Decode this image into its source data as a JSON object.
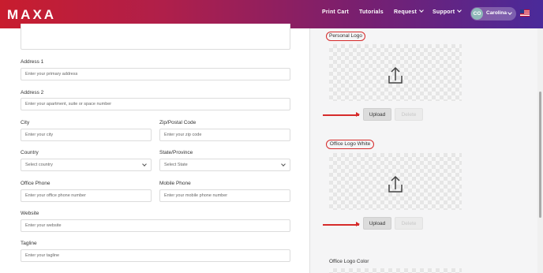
{
  "header": {
    "logo": "MAXA",
    "nav": [
      "Print Cart",
      "Tutorials",
      "Request",
      "Support"
    ],
    "user": {
      "initials": "CO",
      "name": "Carolina"
    }
  },
  "form": {
    "address1": {
      "label": "Address 1",
      "placeholder": "Enter your primary address"
    },
    "address2": {
      "label": "Address 2",
      "placeholder": "Enter your apartment, suite or space number"
    },
    "city": {
      "label": "City",
      "placeholder": "Enter your city"
    },
    "zip": {
      "label": "Zip/Postal Code",
      "placeholder": "Enter your zip code"
    },
    "country": {
      "label": "Country",
      "value": "Select country"
    },
    "state": {
      "label": "State/Province",
      "value": "Select State"
    },
    "office_phone": {
      "label": "Office Phone",
      "placeholder": "Enter your office phone number"
    },
    "mobile_phone": {
      "label": "Mobile Phone",
      "placeholder": "Enter your mobile phone number"
    },
    "website": {
      "label": "Website",
      "placeholder": "Enter your website"
    },
    "tagline": {
      "label": "Tagline",
      "placeholder": "Enter your tagline"
    }
  },
  "logos": {
    "personal": {
      "label": "Personal Logo",
      "upload": "Upload",
      "delete": "Delete"
    },
    "office_white": {
      "label": "Office Logo White",
      "upload": "Upload",
      "delete": "Delete"
    },
    "office_color": {
      "label": "Office Logo Color"
    }
  },
  "colors": {
    "annotation": "#d62b2b",
    "header_start": "#c81d2e",
    "header_end": "#4a2a9a"
  }
}
